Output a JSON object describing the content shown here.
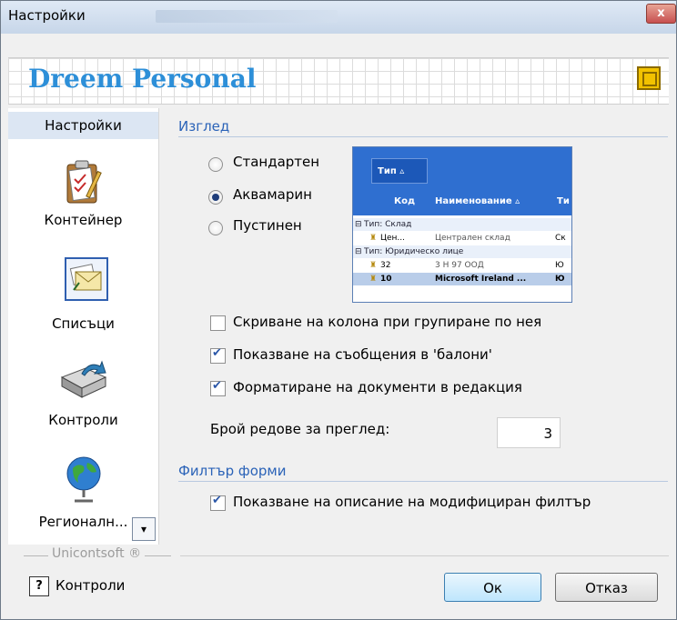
{
  "window": {
    "title": "Настройки",
    "close_glyph": "x"
  },
  "banner": {
    "brand": "Dreem Personal",
    "logo_icon": "app-logo-icon"
  },
  "sidebar": {
    "header": "Настройки",
    "items": [
      {
        "label": "Контейнер",
        "icon": "clipboard-icon"
      },
      {
        "label": "Списъци",
        "icon": "envelope-list-icon"
      },
      {
        "label": "Контроли",
        "icon": "controls-tray-icon"
      },
      {
        "label": "Регионалн...",
        "icon": "globe-icon"
      }
    ],
    "scroll_glyph": "▾"
  },
  "footer": {
    "company": "Unicontsoft ®",
    "help_glyph": "?",
    "help_label": "Контроли"
  },
  "appearance": {
    "title": "Изглед",
    "themes": [
      {
        "label": "Стандартен",
        "selected": false
      },
      {
        "label": "Аквамарин",
        "selected": true
      },
      {
        "label": "Пустинен",
        "selected": false
      }
    ],
    "preview": {
      "group_button": "Тип",
      "columns": [
        "Код",
        "Наименование",
        "Ти"
      ],
      "rows": [
        {
          "type": "group",
          "text": "Тип: Склад"
        },
        {
          "type": "data",
          "code": "Цен...",
          "name": "Централен склад",
          "extra": "Ск"
        },
        {
          "type": "group",
          "text": "Тип: Юридическо лице"
        },
        {
          "type": "data",
          "code": "32",
          "name": "3 Н 97 ООД",
          "extra": "Ю"
        },
        {
          "type": "data",
          "code": "10",
          "name": "Microsoft Ireland ...",
          "extra": "Ю",
          "selected": true
        }
      ]
    },
    "options": [
      {
        "label": "Скриване на колона при групиране по нея",
        "checked": false
      },
      {
        "label": "Показване на съобщения в 'балони'",
        "checked": true
      },
      {
        "label": "Форматиране на документи в редакция",
        "checked": true
      }
    ],
    "rows_label": "Брой редове за преглед:",
    "rows_value": "3"
  },
  "filter": {
    "title": "Филтър форми",
    "option": {
      "label": "Показване на описание на модифициран филтър",
      "checked": true
    }
  },
  "buttons": {
    "ok": "Ок",
    "cancel": "Отказ"
  },
  "colors": {
    "accent": "#2b63b8",
    "brand": "#2d8fd8",
    "preview_header": "#2f6fd0"
  }
}
